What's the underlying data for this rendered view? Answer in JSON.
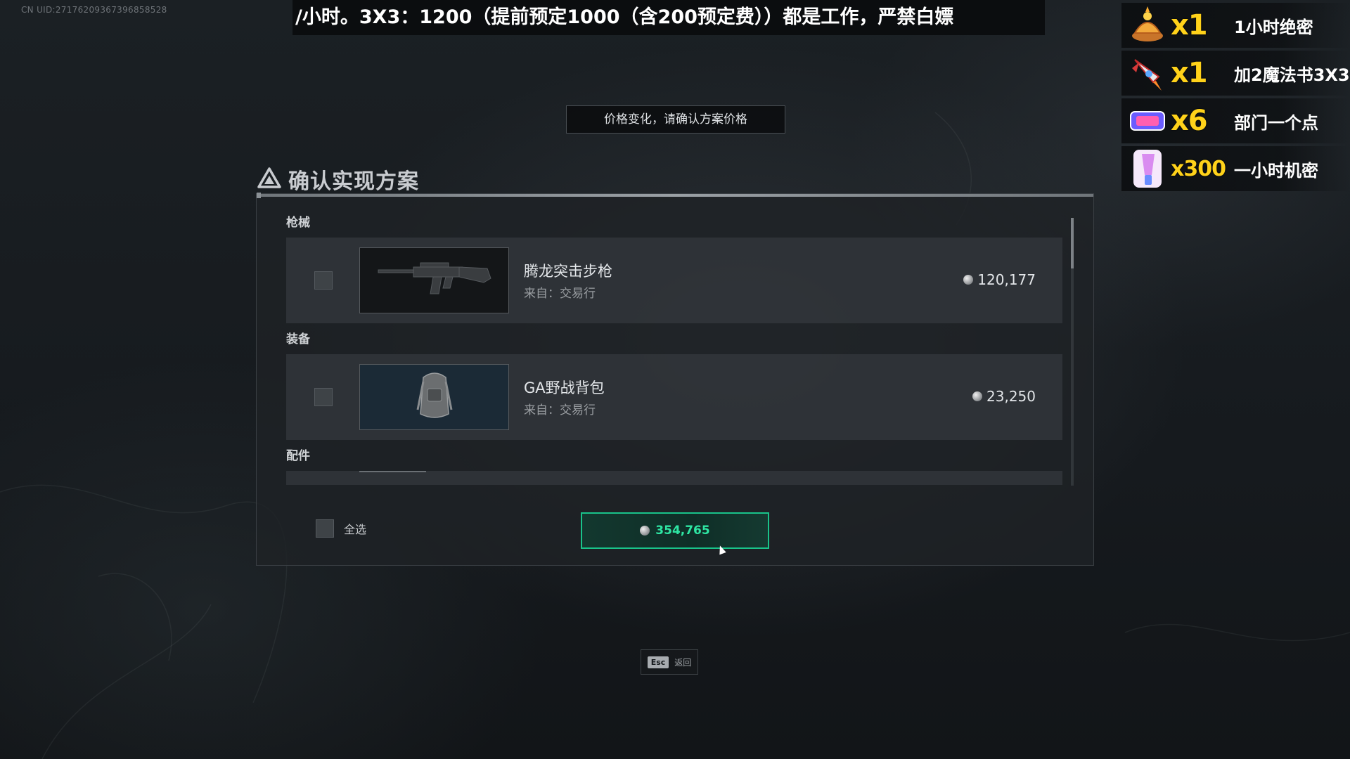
{
  "overlay": {
    "uid": "CN UID:27176209367396858528",
    "ticker_text": "/小时。3X3：1200（提前预定1000（含200预定费））都是工作，严禁白嫖",
    "price_notice": "价格变化，请确认方案价格"
  },
  "dialog": {
    "title": "确认实现方案",
    "title_icon": "warning-triangle-icon",
    "categories": [
      {
        "label": "枪械",
        "items": [
          {
            "name": "腾龙突击步枪",
            "source": "来自：交易行",
            "price": "120,177",
            "thumb": "assault-rifle-icon"
          }
        ]
      },
      {
        "label": "装备",
        "items": [
          {
            "name": "GA野战背包",
            "source": "来自：交易行",
            "price": "23,250",
            "thumb": "backpack-icon"
          }
        ]
      },
      {
        "label": "配件",
        "items": []
      }
    ],
    "select_all_label": "全选",
    "total_price": "354,765",
    "back_key": "Esc",
    "back_label": "返回"
  },
  "gifts": [
    {
      "count": "x1",
      "label": "1小时绝密",
      "icon": "lamp-gift-icon"
    },
    {
      "count": "x1",
      "label": "加2魔法书3X3",
      "icon": "rocket-gift-icon"
    },
    {
      "count": "x6",
      "label": "部门一个点",
      "icon": "badge-gift-icon"
    },
    {
      "count": "x300",
      "label": "一小时机密",
      "icon": "lightstick-gift-icon"
    }
  ],
  "colors": {
    "accent_green": "#19c38a",
    "gift_count_yellow": "#ffd21a"
  }
}
